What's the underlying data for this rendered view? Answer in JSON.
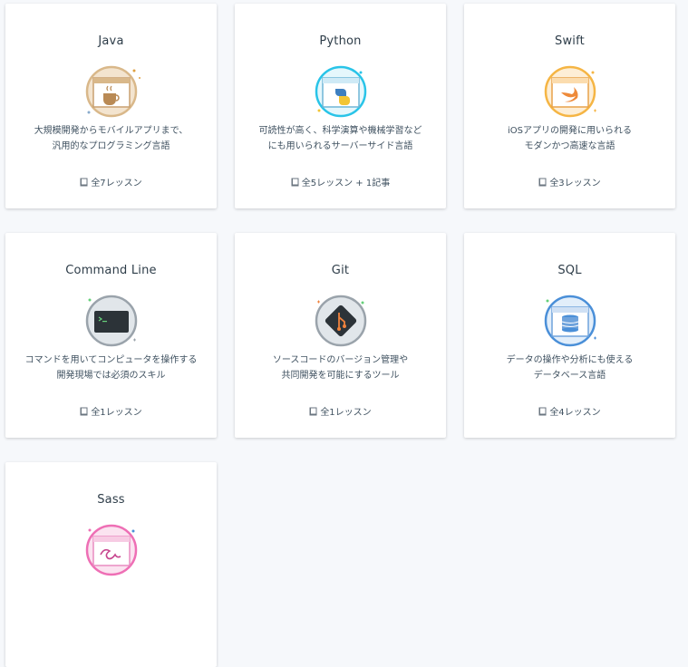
{
  "courses": [
    {
      "title": "Java",
      "icon": "java-coffee-icon",
      "desc_lines": [
        "大規模開発からモバイルアプリまで、",
        "汎用的なプログラミング言語"
      ],
      "lessons": "全7レッスン",
      "color": "#d9b88a"
    },
    {
      "title": "Python",
      "icon": "python-logo-icon",
      "desc_lines": [
        "可読性が高く、科学演算や機械学習など",
        "にも用いられるサーバーサイド言語"
      ],
      "lessons": "全5レッスン + 1記事",
      "color": "#29c4e8"
    },
    {
      "title": "Swift",
      "icon": "swift-bird-icon",
      "desc_lines": [
        "iOSアプリの開発に用いられる",
        "モダンかつ高速な言語"
      ],
      "lessons": "全3レッスン",
      "color": "#f5b544"
    },
    {
      "title": "Command Line",
      "icon": "terminal-icon",
      "desc_lines": [
        "コマンドを用いてコンピュータを操作する",
        "開発現場では必須のスキル"
      ],
      "lessons": "全1レッスン",
      "color": "#9aa3ab"
    },
    {
      "title": "Git",
      "icon": "git-logo-icon",
      "desc_lines": [
        "ソースコードのバージョン管理や",
        "共同開発を可能にするツール"
      ],
      "lessons": "全1レッスン",
      "color": "#9aa3ab"
    },
    {
      "title": "SQL",
      "icon": "database-icon",
      "desc_lines": [
        "データの操作や分析にも使える",
        "データベース言語"
      ],
      "lessons": "全4レッスン",
      "color": "#4a8fd8"
    },
    {
      "title": "Sass",
      "icon": "sass-logo-icon",
      "desc_lines": [],
      "lessons": "",
      "color": "#ee6fb5"
    }
  ]
}
